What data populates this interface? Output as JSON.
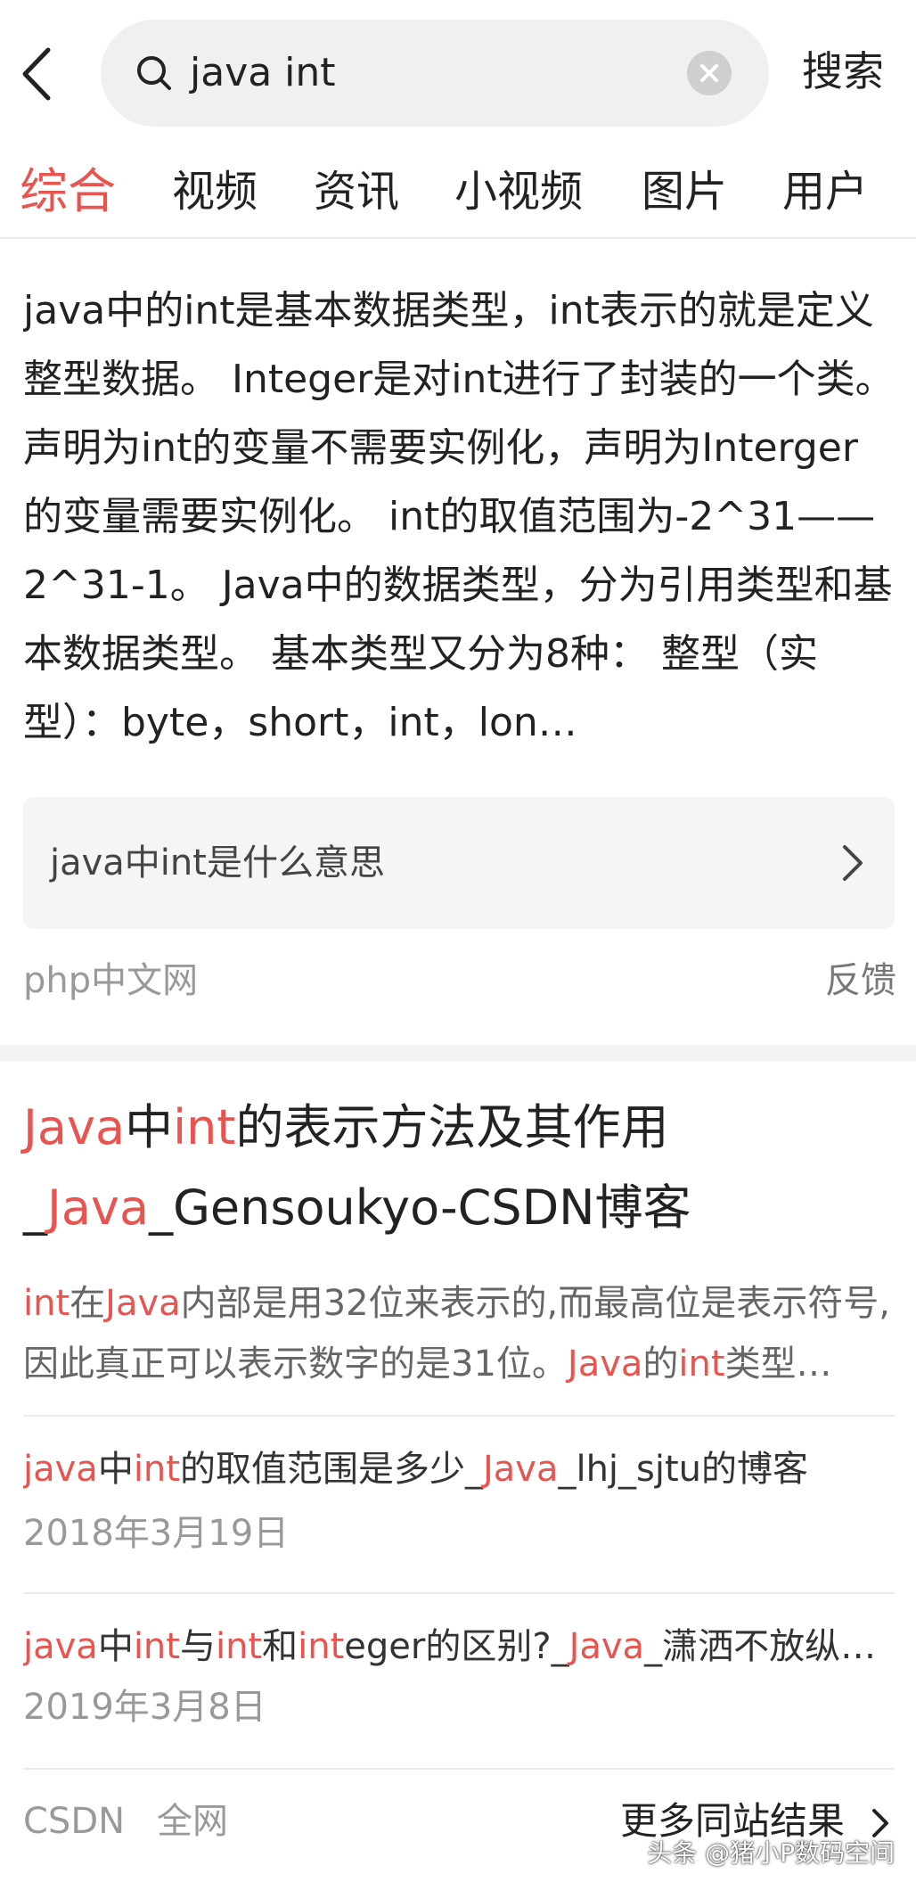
{
  "header": {
    "search_query": "java int",
    "search_button": "搜索"
  },
  "tabs": [
    {
      "label": "综合",
      "active": true
    },
    {
      "label": "视频",
      "active": false
    },
    {
      "label": "资讯",
      "active": false
    },
    {
      "label": "小视频",
      "active": false
    },
    {
      "label": "图片",
      "active": false
    },
    {
      "label": "用户",
      "active": false
    }
  ],
  "answer_card": {
    "summary": "java中的int是基本数据类型，int表示的就是定义整型数据。 Integer是对int进行了封装的一个类。 声明为int的变量不需要实例化，声明为Interger的变量需要实例化。 int的取值范围为-2^31——2^31-1。 Java中的数据类型，分为引用类型和基本数据类型。 基本类型又分为8种： 整型（实型）：byte，short，int，lon…",
    "related_query": "java中int是什么意思",
    "source": "php中文网",
    "feedback": "反馈"
  },
  "result_card": {
    "title_parts": [
      "Java",
      "中",
      "int",
      "的表示方法及其作用_",
      "Java",
      "_Gensoukyo-CSDN博客"
    ],
    "snippet_parts": [
      "int",
      "在",
      "Java",
      "内部是用32位来表示的,而最高位是表示符号,因此真正可以表示数字的是31位。",
      "Java",
      "的",
      "int",
      "类型…"
    ],
    "sub_results": [
      {
        "title_parts": [
          "java",
          "中",
          "int",
          "的取值范围是多少_",
          "Java",
          "_lhj_sjtu的博客"
        ],
        "date": "2018年3月19日"
      },
      {
        "title_parts": [
          "java",
          "中",
          "int",
          "与",
          "int",
          "和",
          "int",
          "eger的区别?_",
          "Java",
          "_潇洒不放纵的…"
        ],
        "date": "2019年3月8日"
      }
    ],
    "footer": {
      "site": "CSDN",
      "scope": "全网",
      "more": "更多同站结果"
    }
  },
  "watermark": "头条 @猪小P数码空间",
  "colors": {
    "accent": "#e85450",
    "search_bg": "#f0f0f0"
  },
  "icons": [
    "back-arrow-icon",
    "search-icon",
    "clear-icon",
    "chevron-right-icon"
  ]
}
